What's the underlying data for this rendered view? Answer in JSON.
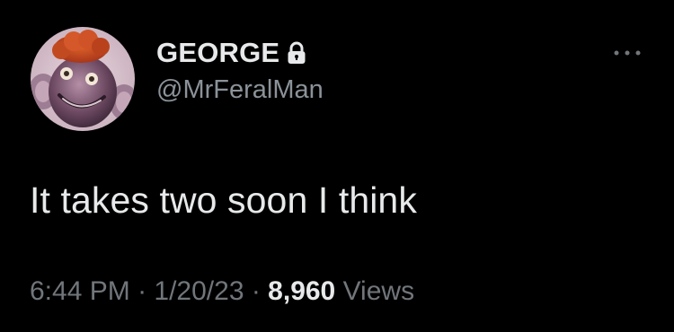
{
  "user": {
    "display_name": "GEORGE",
    "handle": "@MrFeralMan",
    "avatar_icon": "clown-character-avatar",
    "lock_icon": "lock-icon"
  },
  "tweet": {
    "text": "It takes two soon I think",
    "time": "6:44 PM",
    "separator1": " · ",
    "date": "1/20/23",
    "separator2": " · ",
    "views_count": "8,960",
    "views_label": " Views"
  },
  "colors": {
    "background": "#000000",
    "primary_text": "#e7e9ea",
    "secondary_text": "#71767b",
    "handle_text": "#8b9299"
  }
}
